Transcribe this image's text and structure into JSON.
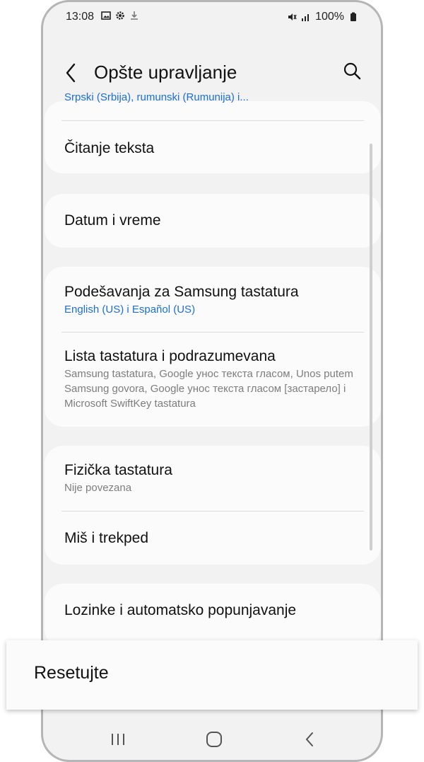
{
  "status_bar": {
    "time": "13:08",
    "left_icons": [
      "gallery-icon",
      "gear-icon",
      "download-icon"
    ],
    "right_icons": [
      "mute-icon",
      "signal-icon",
      "battery-icon"
    ],
    "battery": "100%"
  },
  "header": {
    "title": "Opšte upravljanje"
  },
  "list": {
    "cut_off_subtitle": "Srpski (Srbija), rumunski (Rumunija) i...",
    "text_to_speech": {
      "label": "Čitanje teksta"
    },
    "date_time": {
      "label": "Datum i vreme"
    },
    "samsung_keyboard": {
      "label": "Podešavanja za Samsung tastatura",
      "sub": "English (US) i Español (US)"
    },
    "keyboard_list": {
      "label": "Lista tastatura i podrazumevana",
      "sub": "Samsung tastatura, Google унос текста гласом, Unos putem Samsung govora, Google унос текста гласом [застарело] i Microsoft SwiftKey tastatura"
    },
    "physical_keyboard": {
      "label": "Fizička tastatura",
      "sub": "Nije povezana"
    },
    "mouse_trackpad": {
      "label": "Miš i trekped"
    },
    "passwords_autofill": {
      "label": "Lozinke i automatsko popunjavanje"
    }
  },
  "popup": {
    "reset_label": "Resetujte"
  },
  "nav_bar": {
    "items": [
      "recent-apps-icon",
      "home-icon",
      "back-icon"
    ]
  },
  "colors": {
    "accent": "#1b6fd3",
    "background": "#f2f2f2",
    "card": "#fbfbfb"
  }
}
